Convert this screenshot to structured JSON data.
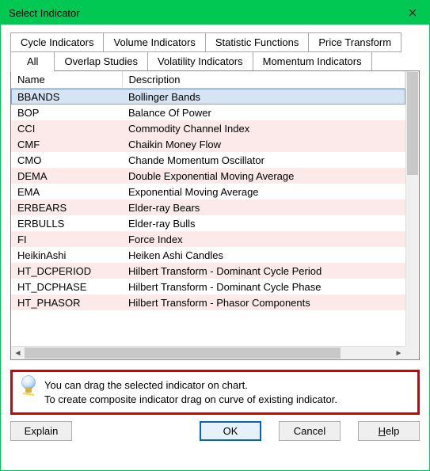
{
  "window": {
    "title": "Select Indicator"
  },
  "tabs": {
    "row1": [
      {
        "label": "Cycle Indicators"
      },
      {
        "label": "Volume Indicators"
      },
      {
        "label": "Statistic Functions"
      },
      {
        "label": "Price Transform"
      }
    ],
    "row2": [
      {
        "label": "All",
        "active": true
      },
      {
        "label": "Overlap Studies"
      },
      {
        "label": "Volatility Indicators"
      },
      {
        "label": "Momentum Indicators"
      }
    ]
  },
  "table": {
    "headers": {
      "name": "Name",
      "description": "Description"
    },
    "rows": [
      {
        "name": "BBANDS",
        "description": "Bollinger Bands",
        "zebra": true,
        "selected": true
      },
      {
        "name": "BOP",
        "description": "Balance Of Power",
        "zebra": false
      },
      {
        "name": "CCI",
        "description": "Commodity Channel Index",
        "zebra": true
      },
      {
        "name": "CMF",
        "description": "Chaikin Money Flow",
        "zebra": false
      },
      {
        "name": "CMO",
        "description": "Chande Momentum Oscillator",
        "zebra": true
      },
      {
        "name": "DEMA",
        "description": "Double Exponential Moving Average",
        "zebra": false
      },
      {
        "name": "EMA",
        "description": "Exponential Moving Average",
        "zebra": true
      },
      {
        "name": "ERBEARS",
        "description": "Elder-ray Bears",
        "zebra": false
      },
      {
        "name": "ERBULLS",
        "description": "Elder-ray Bulls",
        "zebra": true
      },
      {
        "name": "FI",
        "description": "Force Index",
        "zebra": false
      },
      {
        "name": "HeikinAshi",
        "description": "Heiken Ashi Candles",
        "zebra": true
      },
      {
        "name": "HT_DCPERIOD",
        "description": "Hilbert Transform - Dominant Cycle Period",
        "zebra": false
      },
      {
        "name": "HT_DCPHASE",
        "description": "Hilbert Transform - Dominant Cycle Phase",
        "zebra": true
      },
      {
        "name": "HT_PHASOR",
        "description": "Hilbert Transform - Phasor Components",
        "zebra": false
      }
    ],
    "zebra_map": [
      true,
      false,
      true,
      true,
      false,
      true,
      false,
      true,
      false,
      true,
      false,
      true,
      false,
      true
    ]
  },
  "hint": {
    "line1": "You can drag the selected indicator on chart.",
    "line2": "To create composite indicator drag on curve of existing indicator."
  },
  "buttons": {
    "explain": "Explain",
    "ok": "OK",
    "cancel": "Cancel",
    "help_prefix": "H",
    "help_rest": "elp"
  }
}
